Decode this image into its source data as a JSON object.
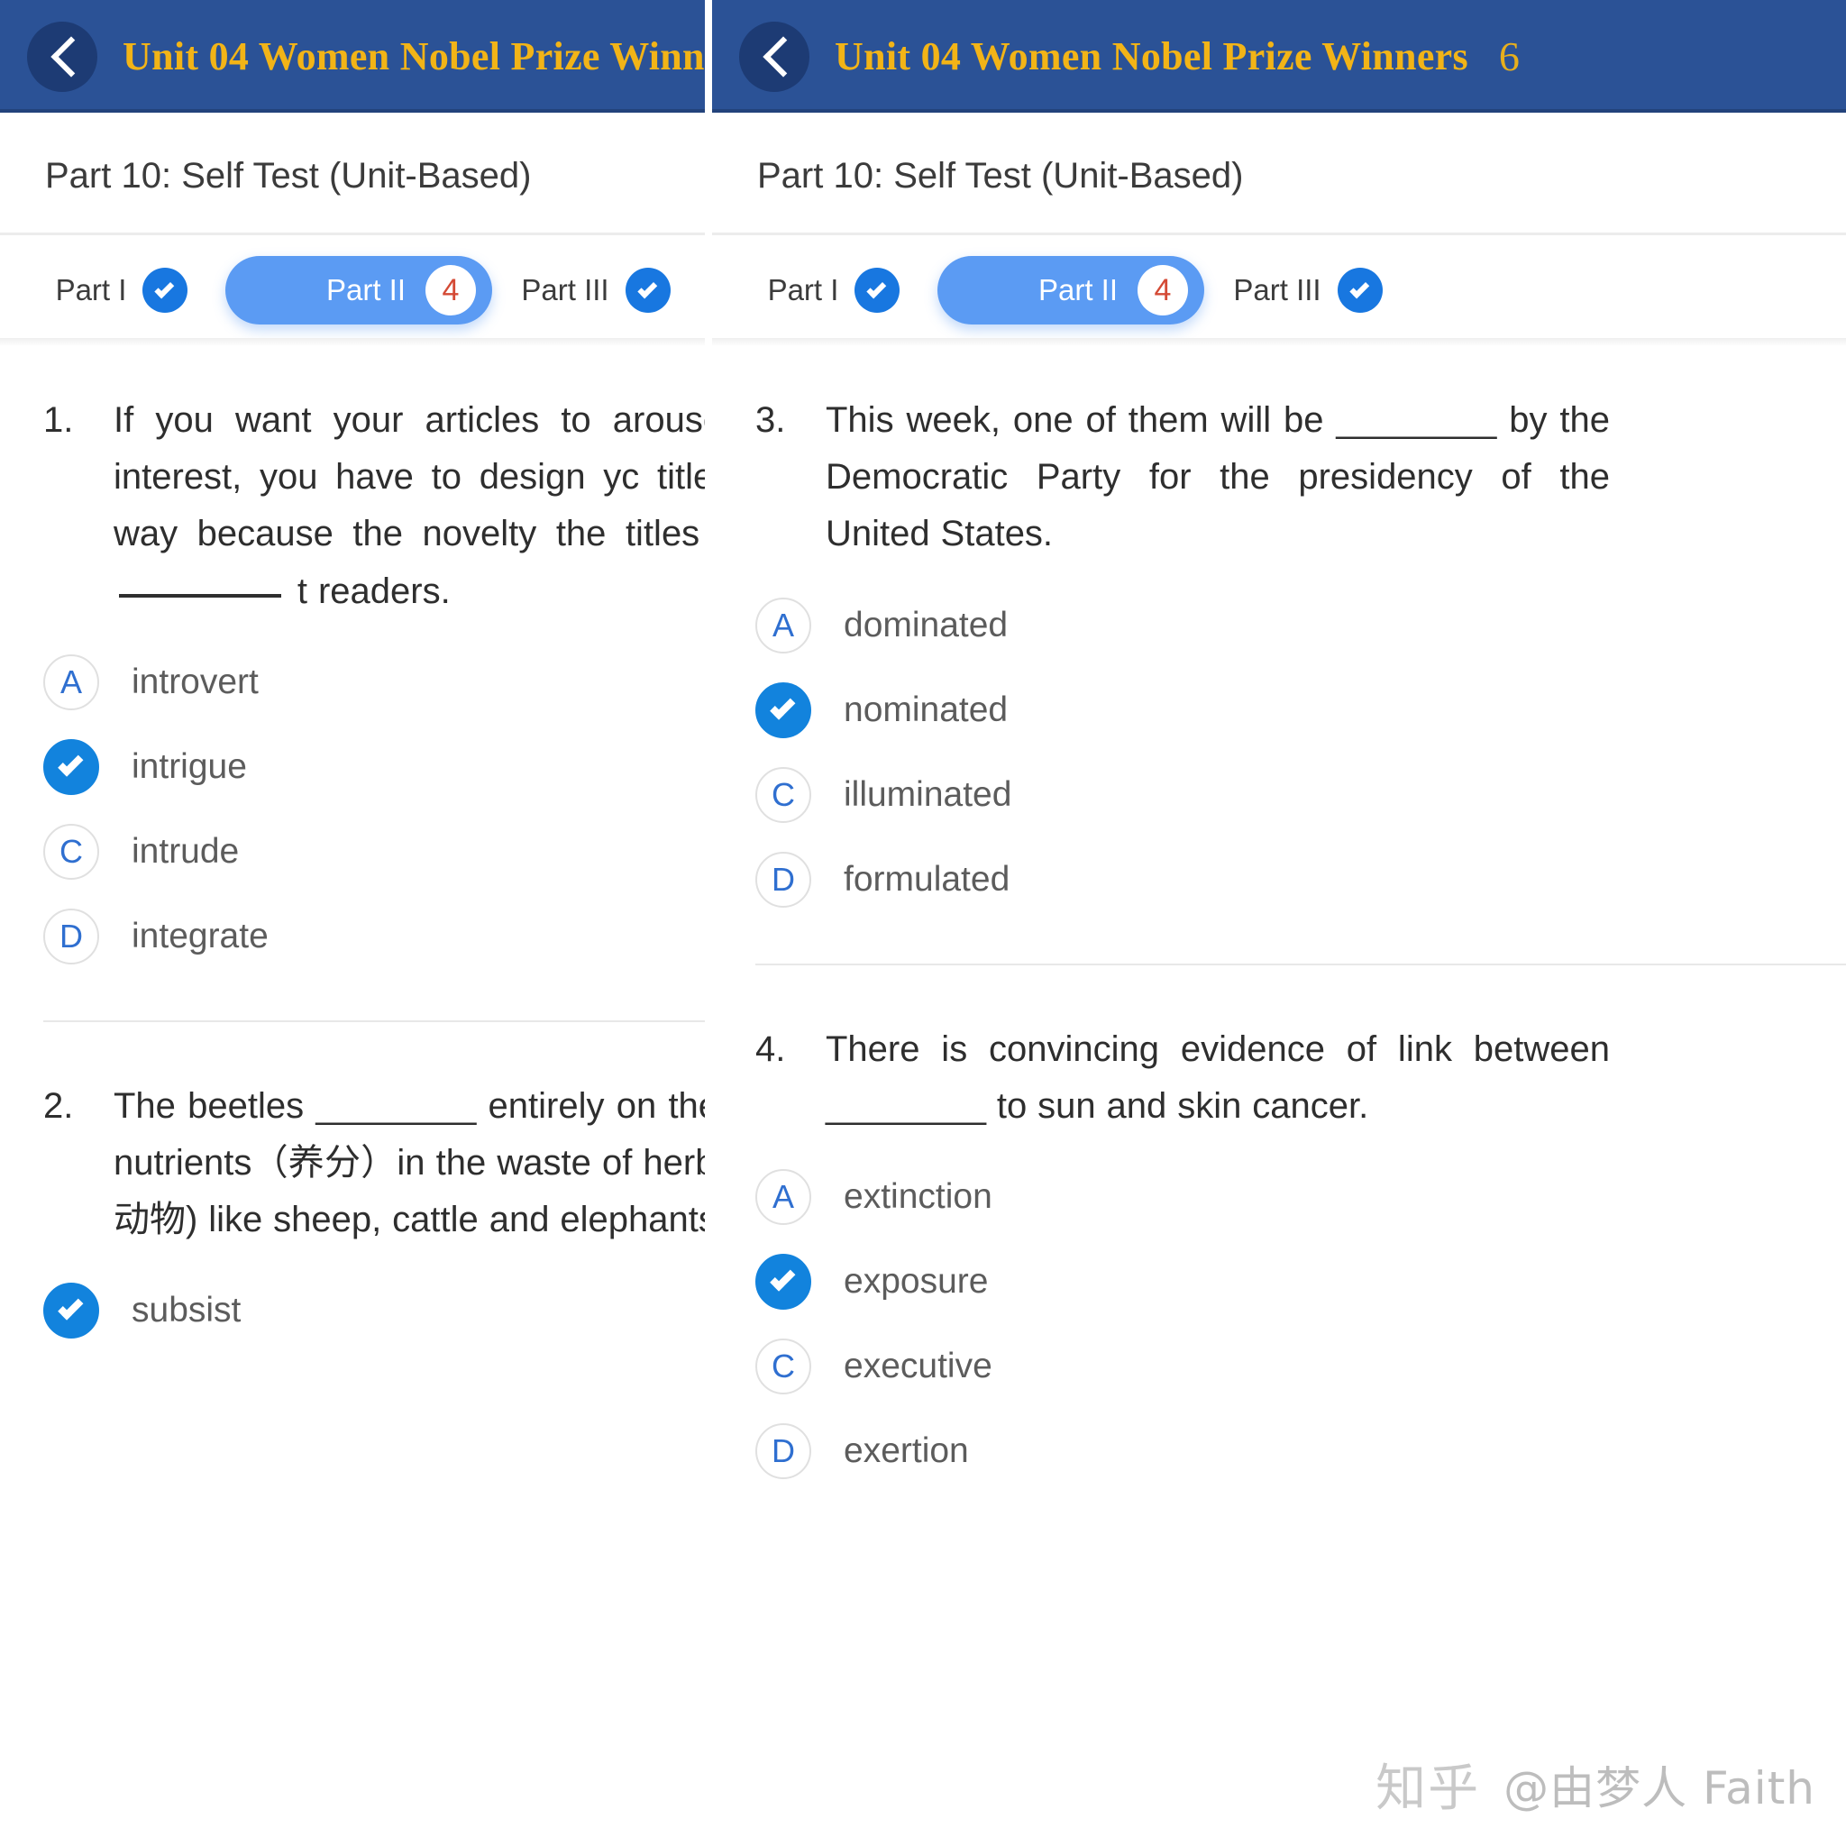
{
  "app": {
    "header": {
      "title": "Unit 04 Women Nobel Prize Winners",
      "trailing_glyph": "6",
      "back_icon": "back-chevron-icon",
      "bar_color": "#2b5296",
      "title_color": "#f2b417"
    },
    "section_heading": "Part 10: Self Test (Unit-Based)",
    "tabs": [
      {
        "label": "Part I",
        "state": "completed",
        "badge": "",
        "active": false
      },
      {
        "label": "Part II",
        "state": "active",
        "badge": "4",
        "active": true
      },
      {
        "label": "Part III",
        "state": "partial",
        "badge": "",
        "active": false
      }
    ],
    "colors": {
      "active_tab": "#5b9bf3",
      "check_badge": "#1877e0",
      "count_badge_text": "#d44a35",
      "selected_option": "#1283dd"
    }
  },
  "left_panel": {
    "questions": [
      {
        "number": "1.",
        "text_parts": [
          "If you want your articles to arouse t",
          "readers’ interest, you have to design yc",
          "title in a better way because the novelty",
          "the titles can always ",
          " t",
          "readers."
        ],
        "text": "If you want your articles to arouse the readers’ interest, you have to design your title in a better way because the novelty of the titles can always ________ the readers.",
        "options": [
          {
            "marker": "A",
            "label": "introvert",
            "selected": false
          },
          {
            "marker": "B",
            "label": "intrigue",
            "selected": true
          },
          {
            "marker": "C",
            "label": "intrude",
            "selected": false
          },
          {
            "marker": "D",
            "label": "integrate",
            "selected": false
          }
        ]
      },
      {
        "number": "2.",
        "text": "The beetles ________ entirely on the undigested nutrients（养分）in the waste of herbivores (食草动物) like sheep, cattle and elephants.",
        "options": [
          {
            "marker": "A",
            "label": "subsist",
            "selected": true
          }
        ]
      }
    ]
  },
  "right_panel": {
    "questions": [
      {
        "number": "3.",
        "text": "This week, one of them will be ________ by the Democratic Party for the presidency of the United States.",
        "options": [
          {
            "marker": "A",
            "label": "dominated",
            "selected": false
          },
          {
            "marker": "B",
            "label": "nominated",
            "selected": true
          },
          {
            "marker": "C",
            "label": "illuminated",
            "selected": false
          },
          {
            "marker": "D",
            "label": "formulated",
            "selected": false
          }
        ]
      },
      {
        "number": "4.",
        "text": "There is convincing evidence of link between ________ to sun and skin cancer.",
        "options": [
          {
            "marker": "A",
            "label": "extinction",
            "selected": false
          },
          {
            "marker": "B",
            "label": "exposure",
            "selected": true
          },
          {
            "marker": "C",
            "label": "executive",
            "selected": false
          },
          {
            "marker": "D",
            "label": "exertion",
            "selected": false
          }
        ]
      }
    ]
  },
  "watermark": {
    "logo": "知乎",
    "user": "@由梦人 Faith"
  }
}
